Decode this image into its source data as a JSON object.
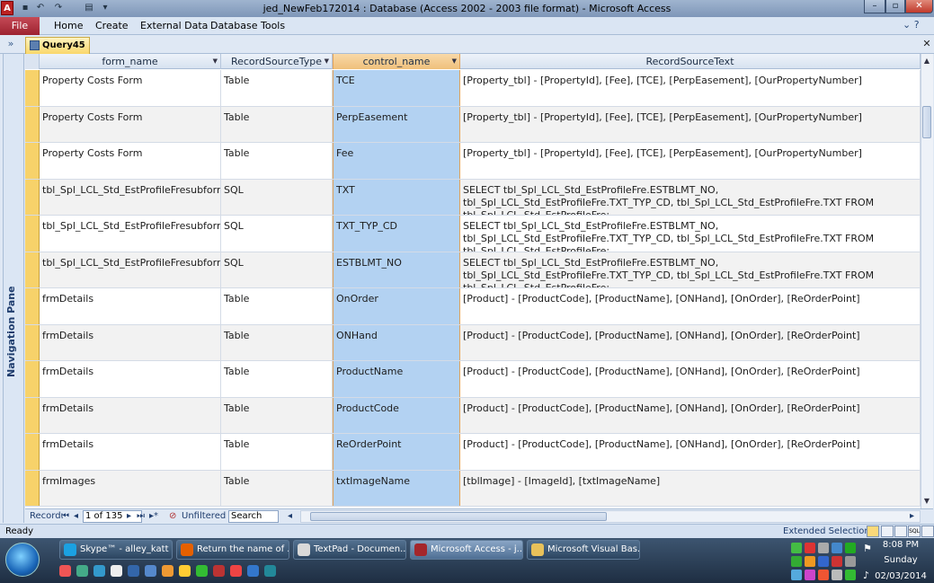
{
  "window": {
    "title": "jed_NewFeb172014 : Database (Access 2002 - 2003 file format)  -  Microsoft Access",
    "app_icon": "A"
  },
  "ribbon": {
    "file": "File",
    "tabs": [
      "Home",
      "Create",
      "External Data",
      "Database Tools"
    ]
  },
  "document": {
    "tab_label": "Query45"
  },
  "nav_pane": {
    "label": "Navigation Pane"
  },
  "grid": {
    "columns": [
      "form_name",
      "RecordSourceType",
      "control_name",
      "RecordSourceText"
    ],
    "rows": [
      [
        "Property Costs Form",
        "Table",
        "TCE",
        "[Property_tbl] - [PropertyId], [Fee], [TCE], [PerpEasement], [OurPropertyNumber]"
      ],
      [
        "Property Costs Form",
        "Table",
        "PerpEasement",
        "[Property_tbl] - [PropertyId], [Fee], [TCE], [PerpEasement], [OurPropertyNumber]"
      ],
      [
        "Property Costs Form",
        "Table",
        "Fee",
        "[Property_tbl] - [PropertyId], [Fee], [TCE], [PerpEasement], [OurPropertyNumber]"
      ],
      [
        "tbl_Spl_LCL_Std_EstProfileFresubform",
        "SQL",
        "TXT",
        "SELECT tbl_Spl_LCL_Std_EstProfileFre.ESTBLMT_NO, tbl_Spl_LCL_Std_EstProfileFre.TXT_TYP_CD, tbl_Spl_LCL_Std_EstProfileFre.TXT FROM tbl_Spl_LCL_Std_EstProfileFre;"
      ],
      [
        "tbl_Spl_LCL_Std_EstProfileFresubform",
        "SQL",
        "TXT_TYP_CD",
        "SELECT tbl_Spl_LCL_Std_EstProfileFre.ESTBLMT_NO, tbl_Spl_LCL_Std_EstProfileFre.TXT_TYP_CD, tbl_Spl_LCL_Std_EstProfileFre.TXT FROM tbl_Spl_LCL_Std_EstProfileFre;"
      ],
      [
        "tbl_Spl_LCL_Std_EstProfileFresubform",
        "SQL",
        "ESTBLMT_NO",
        "SELECT tbl_Spl_LCL_Std_EstProfileFre.ESTBLMT_NO, tbl_Spl_LCL_Std_EstProfileFre.TXT_TYP_CD, tbl_Spl_LCL_Std_EstProfileFre.TXT FROM tbl_Spl_LCL_Std_EstProfileFre;"
      ],
      [
        "frmDetails",
        "Table",
        "OnOrder",
        "[Product] - [ProductCode], [ProductName], [ONHand], [OnOrder], [ReOrderPoint]"
      ],
      [
        "frmDetails",
        "Table",
        "ONHand",
        "[Product] - [ProductCode], [ProductName], [ONHand], [OnOrder], [ReOrderPoint]"
      ],
      [
        "frmDetails",
        "Table",
        "ProductName",
        "[Product] - [ProductCode], [ProductName], [ONHand], [OnOrder], [ReOrderPoint]"
      ],
      [
        "frmDetails",
        "Table",
        "ProductCode",
        "[Product] - [ProductCode], [ProductName], [ONHand], [OnOrder], [ReOrderPoint]"
      ],
      [
        "frmDetails",
        "Table",
        "ReOrderPoint",
        "[Product] - [ProductCode], [ProductName], [ONHand], [OnOrder], [ReOrderPoint]"
      ],
      [
        "frmImages",
        "Table",
        "txtImageName",
        "[tblImage] - [ImageId], [txtImageName]"
      ]
    ]
  },
  "record_nav": {
    "label": "Record:",
    "position": "1 of 135",
    "filter": "Unfiltered",
    "search_placeholder": "Search"
  },
  "status": {
    "ready": "Ready",
    "mode": "Extended Selection"
  },
  "taskbar": {
    "items": [
      {
        "label": "Skype™ - alley_katt",
        "icon": "skype-icon",
        "color": "#1ba1e2"
      },
      {
        "label": "Return the name of ...",
        "icon": "firefox-icon",
        "color": "#e66000"
      },
      {
        "label": "TextPad - Documen...",
        "icon": "textpad-icon",
        "color": "#d9d9d9"
      },
      {
        "label": "Microsoft Access - j...",
        "icon": "access-icon",
        "color": "#a4262c",
        "active": true
      },
      {
        "label": "Microsoft Visual Bas...",
        "icon": "vba-icon",
        "color": "#e8c15a"
      }
    ],
    "clock": {
      "time": "8:08 PM",
      "day": "Sunday",
      "date": "02/03/2014"
    }
  }
}
